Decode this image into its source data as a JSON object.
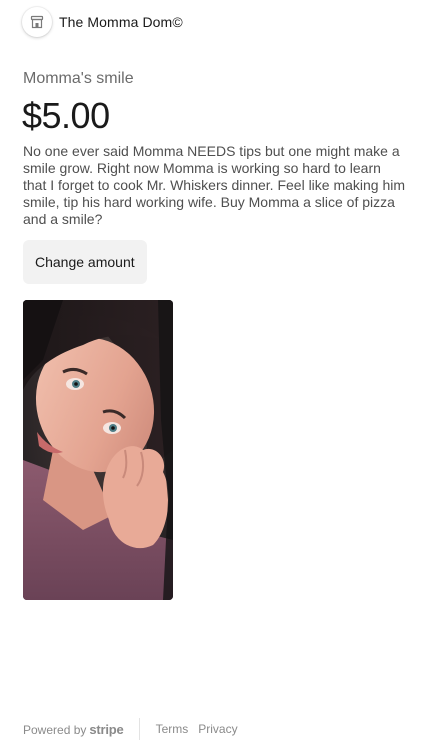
{
  "header": {
    "merchant_name": "The Momma Dom©",
    "logo_icon": "storefront-icon"
  },
  "product": {
    "name": "Momma's smile",
    "price": "$5.00",
    "description": "No one ever said Momma NEEDS tips but one might make a smile grow. Right now Momma is working so hard to learn that I forget to cook Mr. Whiskers dinner. Feel like making him smile, tip his hard working wife. Buy Momma a slice of pizza and a smile?",
    "change_amount_label": "Change amount",
    "image_alt": "Photo of Momma"
  },
  "footer": {
    "powered_by": "Powered by",
    "powered_brand": "stripe",
    "terms_label": "Terms",
    "privacy_label": "Privacy"
  }
}
